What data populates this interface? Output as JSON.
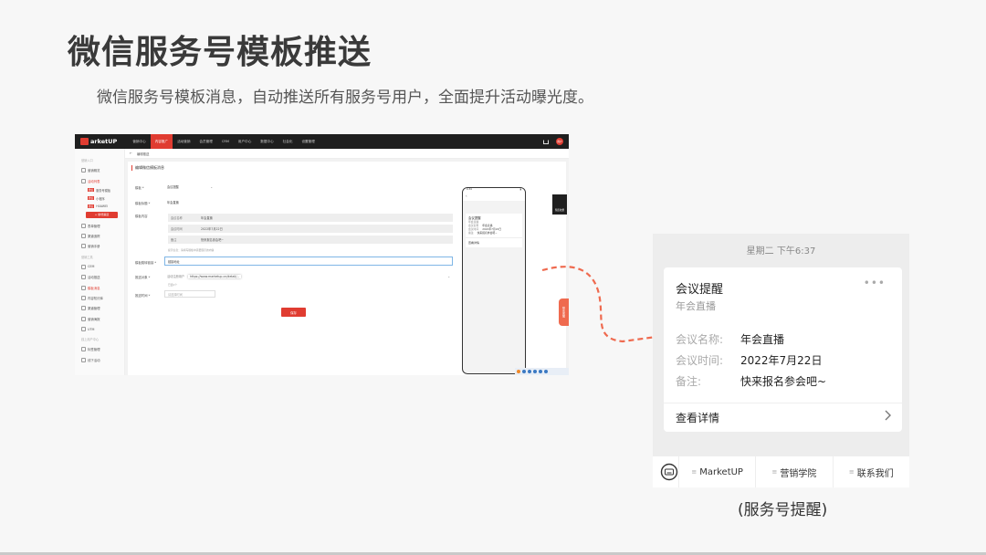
{
  "slide": {
    "title": "微信服务号模板推送",
    "subtitle": "微信服务号模板消息，自动推送所有服务号用户，全面提升活动曝光度。",
    "caption": "(服务号提醒)"
  },
  "app": {
    "logo": "arketUP",
    "nav": [
      "营销中心",
      "内容推广",
      "活动营销",
      "会员管理",
      "CRM",
      "用户中心",
      "数据中心",
      "社会化",
      "设置管理"
    ],
    "avatar": "用户",
    "sidebar": {
      "group1": "营销入口",
      "item1": "营销概览",
      "item2": "活动列表",
      "subs": [
        {
          "tag": "微信",
          "label": "服务号模板"
        },
        {
          "tag": "微信",
          "label": "小程序"
        },
        {
          "tag": "微信",
          "label": "HUAWEI"
        }
      ],
      "add_btn": "+ 新增渠道",
      "items_a": [
        "表单管理",
        "渠道追踪",
        "营销手册"
      ],
      "group2": "营销工具",
      "items_b": [
        "CEM",
        "活动推送",
        "模板消息",
        "内容知识库",
        "渠道管理",
        "营销海报",
        "UTM"
      ],
      "group3": "线上用户中心",
      "items_c": [
        "标签管理",
        "线下活动"
      ]
    },
    "crumb": {
      "back": "←",
      "title": "编辑推送"
    },
    "form": {
      "panel_title": "编辑微信模板消息",
      "template_label": "模板 *",
      "template_value": "会议提醒",
      "title_label": "模板标题 *",
      "title_value": "年会直播",
      "content_label": "模板内容",
      "rows": [
        {
          "k": "会议名称",
          "v": "年会直播"
        },
        {
          "k": "会议时间",
          "v": "2022年7月22日"
        },
        {
          "k": "备注",
          "v": "快来报名参会吧~"
        }
      ],
      "hint": "提示信息：请填写模板中需要展示的内容",
      "link_label": "模板跳转链接 *",
      "link_value": "链接地址",
      "sender_label": "推送对象 *",
      "sender_tag": "活动注册用户",
      "sender_url": "https://www.marketup.cn/detail/...",
      "sender_hint": "已选1个",
      "time_label": "推送时间 *",
      "time_value": "请选择时间",
      "save": "保存"
    },
    "phone": {
      "time": "6:34",
      "card_title": "会议提醒",
      "card_sub": "年会直播",
      "rows": [
        {
          "k": "会议名称",
          "v": "年会直播"
        },
        {
          "k": "会议时间",
          "v": "2022年7月22日"
        },
        {
          "k": "备注",
          "v": "快来报名参会吧~"
        }
      ],
      "detail": "查看详情",
      "side_btn": "预览效果",
      "float_tab": "联系客服"
    }
  },
  "notify": {
    "time": "星期二 下午6:37",
    "title": "会议提醒",
    "sub": "年会直播",
    "rows": [
      {
        "k": "会议名称:",
        "v": "年会直播"
      },
      {
        "k": "会议时间:",
        "v": "2022年7月22日"
      },
      {
        "k": "备注:",
        "v": "快来报名参会吧~"
      }
    ],
    "more": "查看详情",
    "dots": "•••",
    "menu": [
      "MarketUP",
      "营销学院",
      "联系我们"
    ]
  },
  "colors": {
    "accent": "#e03c31",
    "arrow": "#ef6a4f"
  }
}
